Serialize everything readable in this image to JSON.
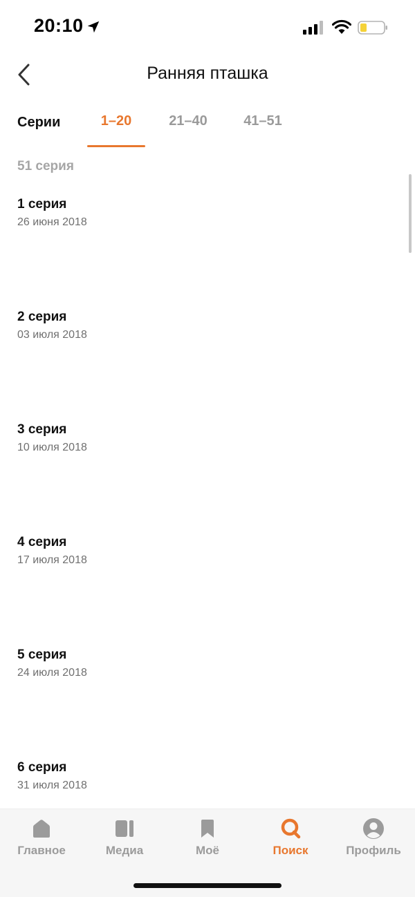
{
  "status_bar": {
    "time": "20:10"
  },
  "header": {
    "title": "Ранняя пташка"
  },
  "tabs": {
    "label": "Серии",
    "items": [
      {
        "label": "1–20",
        "active": true
      },
      {
        "label": "21–40",
        "active": false
      },
      {
        "label": "41–51",
        "active": false
      }
    ]
  },
  "episode_count": "51 серия",
  "episodes": [
    {
      "title": "1 серия",
      "date": "26 июня 2018"
    },
    {
      "title": "2 серия",
      "date": "03 июля 2018"
    },
    {
      "title": "3 серия",
      "date": "10 июля 2018"
    },
    {
      "title": "4 серия",
      "date": "17 июля 2018"
    },
    {
      "title": "5 серия",
      "date": "24 июля 2018"
    },
    {
      "title": "6 серия",
      "date": "31 июля 2018"
    }
  ],
  "bottom_nav": {
    "items": [
      {
        "label": "Главное",
        "icon": "home-icon",
        "active": false
      },
      {
        "label": "Медиа",
        "icon": "media-icon",
        "active": false
      },
      {
        "label": "Моё",
        "icon": "bookmark-icon",
        "active": false
      },
      {
        "label": "Поиск",
        "icon": "search-icon",
        "active": true
      },
      {
        "label": "Профиль",
        "icon": "profile-icon",
        "active": false
      }
    ]
  },
  "colors": {
    "accent": "#e8772e",
    "inactive": "#9b9b9b",
    "battery_fill": "#f5d238"
  }
}
